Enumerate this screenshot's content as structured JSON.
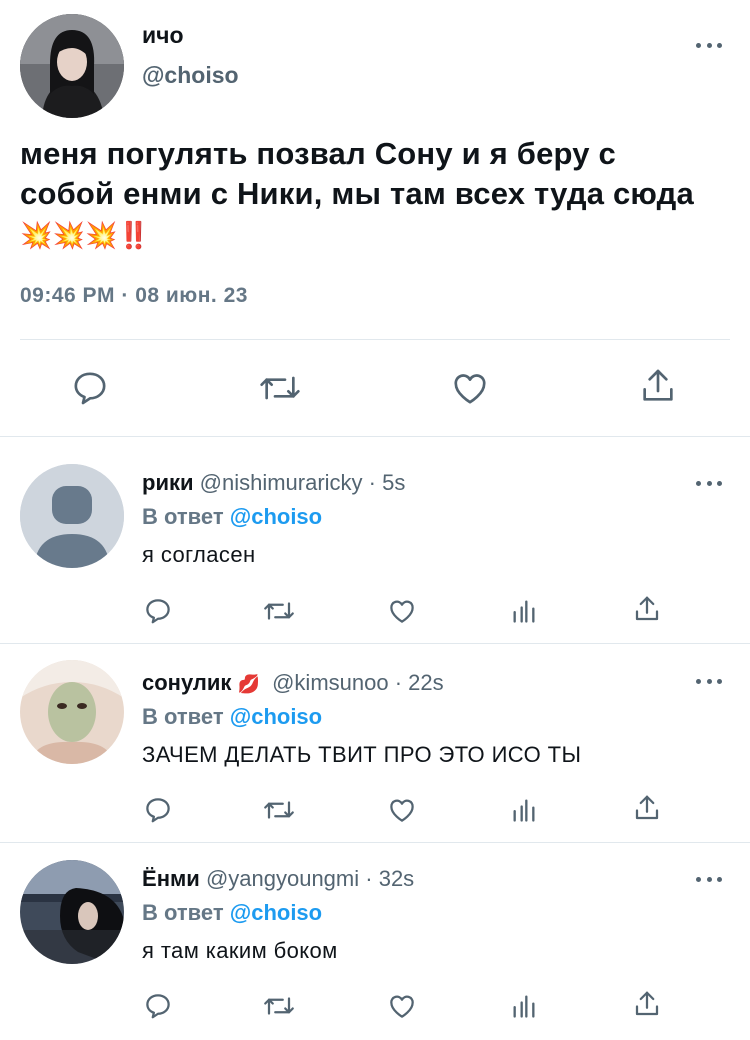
{
  "main_tweet": {
    "name": "ичо",
    "handle": "@choiso",
    "text": "меня погулять позвал Сону и я беру с собой енми с Ники, мы там всех туда сюда",
    "emoji_suffix": "💥💥💥‼️",
    "timestamp": "09:46 PM · 08 июн. 23"
  },
  "replies": [
    {
      "name": "рики",
      "handle": "@nishimuraricky",
      "time": "· 5s",
      "reply_label": "В ответ",
      "reply_to": "@choiso",
      "text": "я согласен"
    },
    {
      "name": "сонулик",
      "name_emoji": "💋",
      "handle": "@kimsunoo",
      "time": "· 22s",
      "reply_label": "В ответ",
      "reply_to": "@choiso",
      "text": "ЗАЧЕМ ДЕЛАТЬ ТВИТ ПРО ЭТО ИСО ТЫ"
    },
    {
      "name": "Ёнми",
      "handle": "@yangyoungmi",
      "time": "· 32s",
      "reply_label": "В ответ",
      "reply_to": "@choiso",
      "text": "я там каким боком"
    }
  ],
  "colors": {
    "text": "#0f1419",
    "secondary": "#536471",
    "accent": "#1d9bf0",
    "divider": "#e1e8ed"
  },
  "icons": [
    "reply-icon",
    "retweet-icon",
    "like-icon",
    "share-icon",
    "views-icon",
    "more-icon"
  ]
}
